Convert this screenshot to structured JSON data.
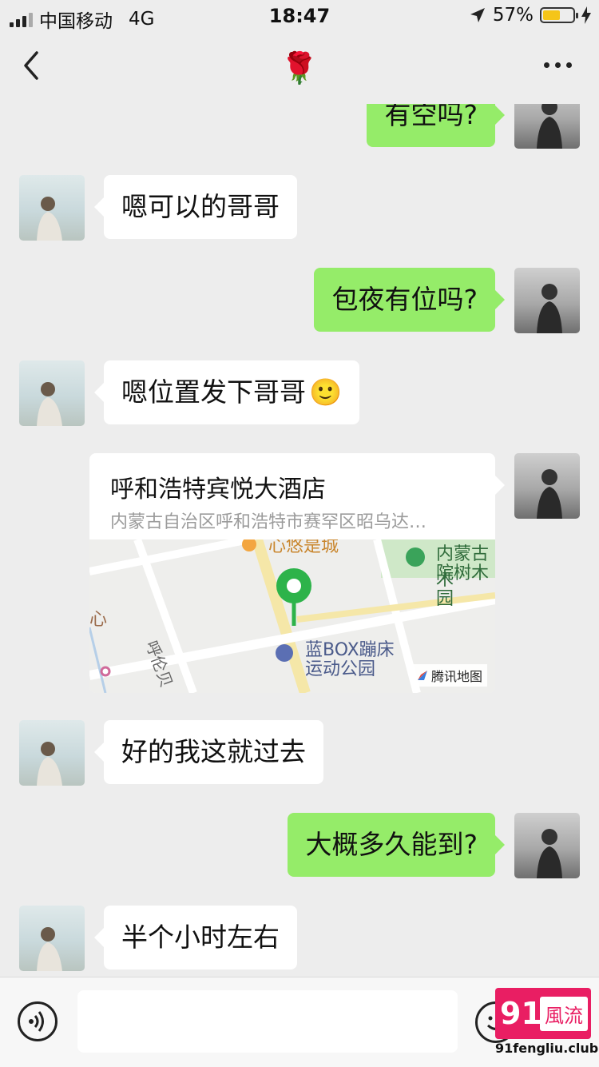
{
  "status_bar": {
    "carrier": "中国移动",
    "network": "4G",
    "time": "18:47",
    "battery_percent": "57%",
    "battery_level": 0.57
  },
  "nav": {
    "title_icon": "rose-emoji",
    "title_emoji": "🌹",
    "back_icon": "chevron-left-icon",
    "more_icon": "ellipsis-icon"
  },
  "messages": [
    {
      "side": "right",
      "text": "有空吗?"
    },
    {
      "side": "left",
      "text": "嗯可以的哥哥"
    },
    {
      "side": "right",
      "text": "包夜有位吗?"
    },
    {
      "side": "left",
      "text": "嗯位置发下哥哥",
      "emoji": "🙂"
    },
    {
      "side": "right",
      "type": "location"
    },
    {
      "side": "left",
      "text": "好的我这就过去"
    },
    {
      "side": "right",
      "text": "大概多久能到?"
    },
    {
      "side": "left",
      "text": "半个小时左右"
    }
  ],
  "location": {
    "name": "呼和浩特宾悦大酒店",
    "address": "内蒙古自治区呼和浩特市赛罕区昭乌达…",
    "map_labels": {
      "top_center": "心悠是城",
      "top_right": "内蒙古树木园",
      "top_right_line1": "内蒙古木",
      "top_right_line2": "院树木园",
      "left_edge": "心",
      "street": "呼伦贝",
      "poi_line1": "蓝BOX蹦床",
      "poi_line2": "运动公园"
    },
    "map_attribution": "腾讯地图"
  },
  "input_bar": {
    "placeholder": "",
    "voice_icon": "voice-icon",
    "emoji_icon": "emoji-icon"
  },
  "watermark": {
    "number": "91",
    "text": "風流",
    "url": "91fengliu.club"
  },
  "colors": {
    "background": "#ededed",
    "sent_bubble": "#95ec69",
    "received_bubble": "#ffffff",
    "battery_fill": "#f5c518",
    "watermark": "#e91e63"
  }
}
